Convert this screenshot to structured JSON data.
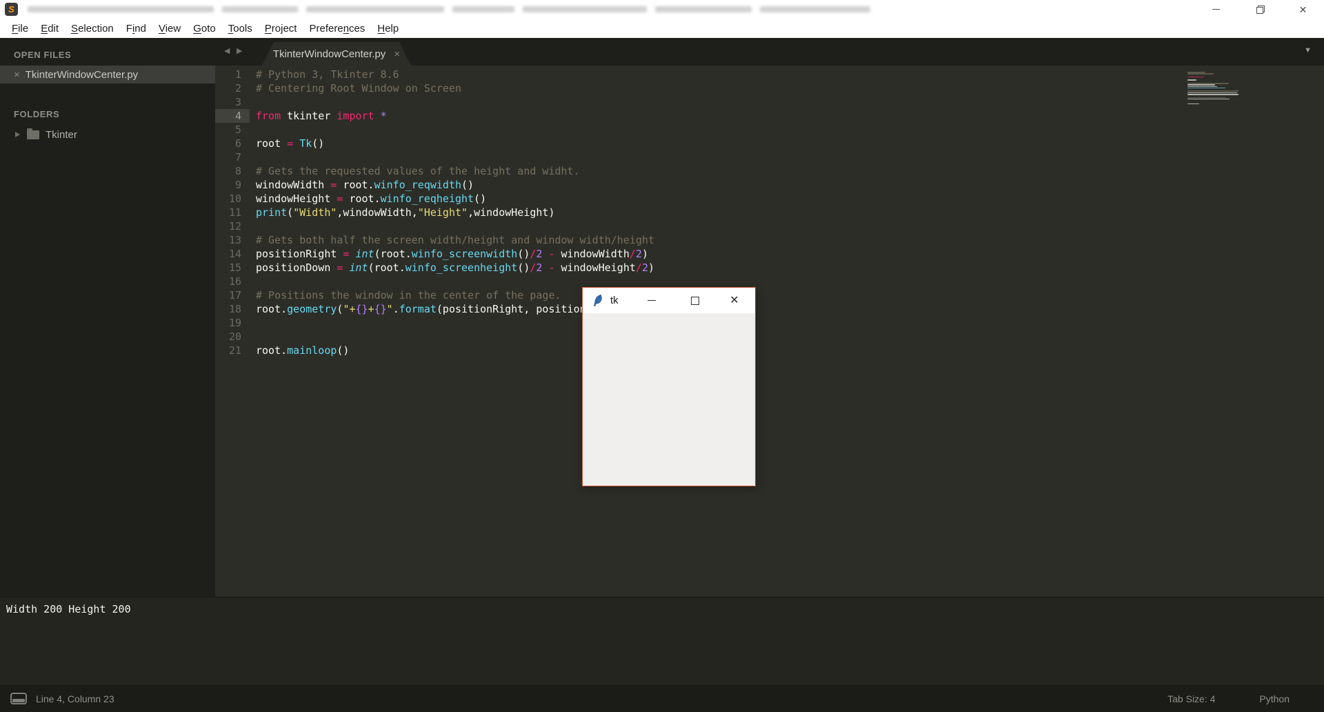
{
  "menu": {
    "items": [
      {
        "pre": "",
        "u": "F",
        "post": "ile"
      },
      {
        "pre": "",
        "u": "E",
        "post": "dit"
      },
      {
        "pre": "",
        "u": "S",
        "post": "election"
      },
      {
        "pre": "F",
        "u": "i",
        "post": "nd"
      },
      {
        "pre": "",
        "u": "V",
        "post": "iew"
      },
      {
        "pre": "",
        "u": "G",
        "post": "oto"
      },
      {
        "pre": "",
        "u": "T",
        "post": "ools"
      },
      {
        "pre": "",
        "u": "P",
        "post": "roject"
      },
      {
        "pre": "Prefere",
        "u": "n",
        "post": "ces"
      },
      {
        "pre": "",
        "u": "H",
        "post": "elp"
      }
    ]
  },
  "sidebar": {
    "open_files_header": "OPEN FILES",
    "open_file": "TkinterWindowCenter.py",
    "folders_header": "FOLDERS",
    "folder": "Tkinter"
  },
  "tabs": {
    "active": "TkinterWindowCenter.py"
  },
  "editor": {
    "lines": [
      {
        "n": 1,
        "hl": false,
        "tokens": [
          [
            "c",
            "# Python 3, Tkinter 8.6"
          ]
        ]
      },
      {
        "n": 2,
        "hl": false,
        "tokens": [
          [
            "c",
            "# Centering Root Window on Screen"
          ]
        ]
      },
      {
        "n": 3,
        "hl": false,
        "tokens": []
      },
      {
        "n": 4,
        "hl": true,
        "tokens": [
          [
            "k",
            "from"
          ],
          [
            "d",
            " tkinter "
          ],
          [
            "k",
            "import"
          ],
          [
            "d",
            " "
          ],
          [
            "n",
            "*"
          ]
        ]
      },
      {
        "n": 5,
        "hl": false,
        "tokens": []
      },
      {
        "n": 6,
        "hl": false,
        "tokens": [
          [
            "d",
            "root "
          ],
          [
            "k",
            "="
          ],
          [
            "d",
            " "
          ],
          [
            "f",
            "Tk"
          ],
          [
            "d",
            "()"
          ]
        ]
      },
      {
        "n": 7,
        "hl": false,
        "tokens": []
      },
      {
        "n": 8,
        "hl": false,
        "tokens": [
          [
            "c",
            "# Gets the requested values of the height and widht."
          ]
        ]
      },
      {
        "n": 9,
        "hl": false,
        "tokens": [
          [
            "d",
            "windowWidth "
          ],
          [
            "k",
            "="
          ],
          [
            "d",
            " root."
          ],
          [
            "f",
            "winfo_reqwidth"
          ],
          [
            "d",
            "()"
          ]
        ]
      },
      {
        "n": 10,
        "hl": false,
        "tokens": [
          [
            "d",
            "windowHeight "
          ],
          [
            "k",
            "="
          ],
          [
            "d",
            " root."
          ],
          [
            "f",
            "winfo_reqheight"
          ],
          [
            "d",
            "()"
          ]
        ]
      },
      {
        "n": 11,
        "hl": false,
        "tokens": [
          [
            "f",
            "print"
          ],
          [
            "d",
            "("
          ],
          [
            "s",
            "\"Width\""
          ],
          [
            "d",
            ",windowWidth,"
          ],
          [
            "s",
            "\"Height\""
          ],
          [
            "d",
            ",windowHeight)"
          ]
        ]
      },
      {
        "n": 12,
        "hl": false,
        "tokens": []
      },
      {
        "n": 13,
        "hl": false,
        "tokens": [
          [
            "c",
            "# Gets both half the screen width/height and window width/height"
          ]
        ]
      },
      {
        "n": 14,
        "hl": false,
        "tokens": [
          [
            "d",
            "positionRight "
          ],
          [
            "k",
            "="
          ],
          [
            "d",
            " "
          ],
          [
            "fi",
            "int"
          ],
          [
            "d",
            "(root."
          ],
          [
            "f",
            "winfo_screenwidth"
          ],
          [
            "d",
            "()"
          ],
          [
            "k",
            "/"
          ],
          [
            "n",
            "2"
          ],
          [
            "d",
            " "
          ],
          [
            "k",
            "-"
          ],
          [
            "d",
            " windowWidth"
          ],
          [
            "k",
            "/"
          ],
          [
            "n",
            "2"
          ],
          [
            "d",
            ")"
          ]
        ]
      },
      {
        "n": 15,
        "hl": false,
        "tokens": [
          [
            "d",
            "positionDown "
          ],
          [
            "k",
            "="
          ],
          [
            "d",
            " "
          ],
          [
            "fi",
            "int"
          ],
          [
            "d",
            "(root."
          ],
          [
            "f",
            "winfo_screenheight"
          ],
          [
            "d",
            "()"
          ],
          [
            "k",
            "/"
          ],
          [
            "n",
            "2"
          ],
          [
            "d",
            " "
          ],
          [
            "k",
            "-"
          ],
          [
            "d",
            " windowHeight"
          ],
          [
            "k",
            "/"
          ],
          [
            "n",
            "2"
          ],
          [
            "d",
            ")"
          ]
        ]
      },
      {
        "n": 16,
        "hl": false,
        "tokens": []
      },
      {
        "n": 17,
        "hl": false,
        "tokens": [
          [
            "c",
            "# Positions the window in the center of the page."
          ]
        ]
      },
      {
        "n": 18,
        "hl": false,
        "tokens": [
          [
            "d",
            "root."
          ],
          [
            "f",
            "geometry"
          ],
          [
            "d",
            "("
          ],
          [
            "s",
            "\"+"
          ],
          [
            "n",
            "{}"
          ],
          [
            "s",
            "+"
          ],
          [
            "n",
            "{}"
          ],
          [
            "s",
            "\""
          ],
          [
            "d",
            "."
          ],
          [
            "f",
            "format"
          ],
          [
            "d",
            "(positionRight, position"
          ]
        ]
      },
      {
        "n": 19,
        "hl": false,
        "tokens": []
      },
      {
        "n": 20,
        "hl": false,
        "tokens": []
      },
      {
        "n": 21,
        "hl": false,
        "tokens": [
          [
            "d",
            "root."
          ],
          [
            "f",
            "mainloop"
          ],
          [
            "d",
            "()"
          ]
        ]
      }
    ]
  },
  "tk_window": {
    "title": "tk"
  },
  "console": {
    "output": "Width 200 Height 200"
  },
  "status_bar": {
    "position": "Line 4, Column 23",
    "tab_size": "Tab Size: 4",
    "syntax": "Python"
  },
  "colors": {
    "editor_bg": "#2d2d28",
    "sidebar_bg": "#1e1e1b",
    "keyword": "#f92672",
    "function": "#66d9ef",
    "number": "#ae81ff",
    "string": "#e6db74",
    "comment": "#75715e",
    "text": "#f8f8f2",
    "tk_border": "#c0512d",
    "sublime_orange": "#ff9b21"
  }
}
